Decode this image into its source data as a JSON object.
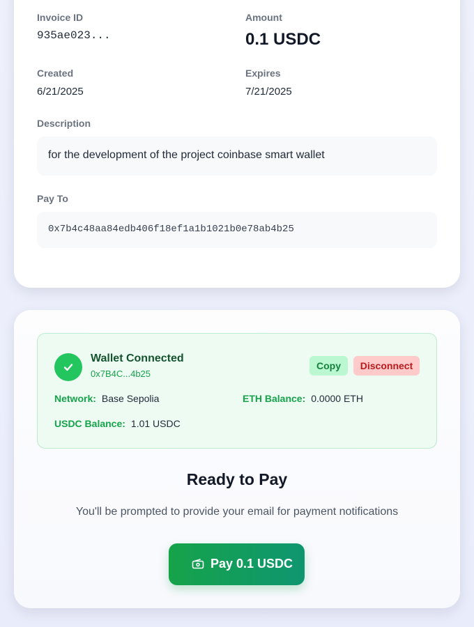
{
  "invoice": {
    "id_label": "Invoice ID",
    "id_value": "935ae023...",
    "amount_label": "Amount",
    "amount_value": "0.1 USDC",
    "created_label": "Created",
    "created_value": "6/21/2025",
    "expires_label": "Expires",
    "expires_value": "7/21/2025",
    "description_label": "Description",
    "description_value": "for the development of the project coinbase smart wallet",
    "payto_label": "Pay To",
    "payto_value": "0x7b4c48aa84edb406f18ef1a1b1021b0e78ab4b25"
  },
  "wallet": {
    "status": "Wallet Connected",
    "address": "0x7B4C...4b25",
    "copy_label": "Copy",
    "disconnect_label": "Disconnect",
    "network_label": "Network:",
    "network_value": "Base Sepolia",
    "eth_label": "ETH Balance:",
    "eth_value": "0.0000 ETH",
    "usdc_label": "USDC Balance:",
    "usdc_value": "1.01 USDC"
  },
  "payment": {
    "title": "Ready to Pay",
    "hint": "You'll be prompted to provide your email for payment notifications",
    "button_label": "Pay 0.1 USDC",
    "button_icon": "wallet-icon"
  },
  "colors": {
    "accent": "#16a34a",
    "success_bg": "#edfbf3",
    "danger": "#b91c1c"
  }
}
